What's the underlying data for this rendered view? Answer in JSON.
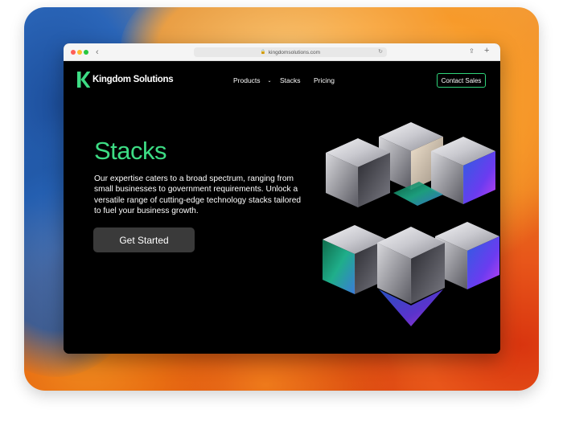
{
  "browser": {
    "url": "kingdomsolutions.com",
    "back_icon": "chevron-left-icon",
    "lock_icon": "lock-icon",
    "reload_icon": "reload-icon",
    "share_icon": "share-icon",
    "new_tab_icon": "plus-icon"
  },
  "header": {
    "brand": "Kingdom Solutions",
    "logo_icon": "k-logo-icon",
    "nav": [
      {
        "label": "Products",
        "has_dropdown": true
      },
      {
        "label": "Stacks"
      },
      {
        "label": "Pricing"
      }
    ],
    "contact_label": "Contact Sales"
  },
  "hero": {
    "title": "Stacks",
    "description": "Our expertise caters to a broad spectrum, ranging from small businesses to government requirements. Unlock a versatile range of cutting-edge technology stacks tailored to fuel your business growth.",
    "cta_label": "Get Started",
    "illustration_icon": "metallic-cubes-illustration"
  },
  "colors": {
    "accent": "#3ddc84",
    "page_bg": "#000000",
    "button_bg": "#3a3a3a"
  }
}
